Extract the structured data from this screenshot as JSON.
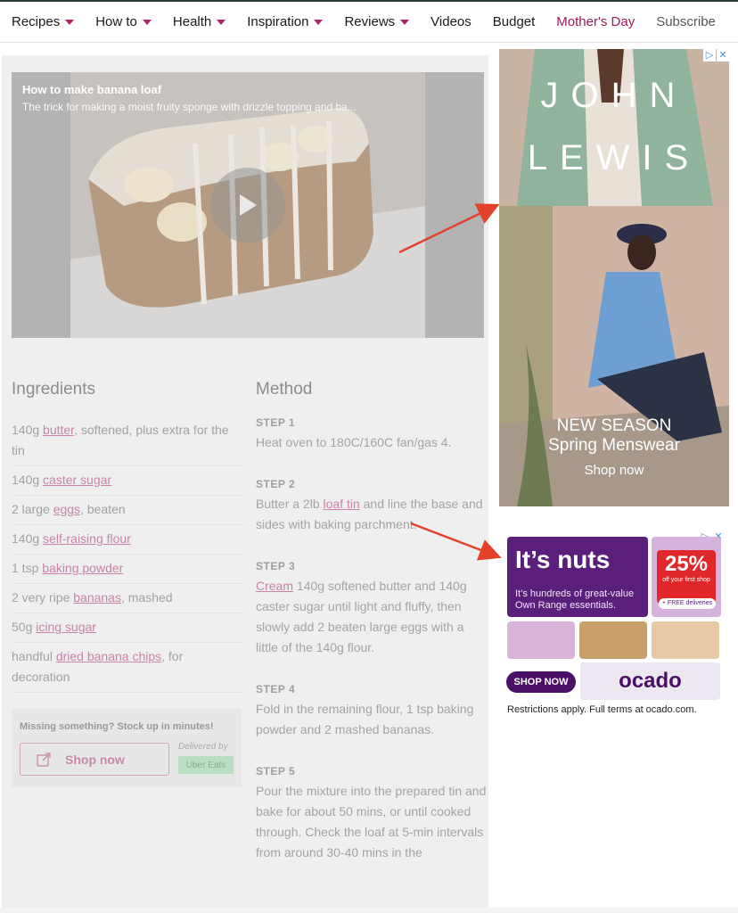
{
  "nav": {
    "items": [
      {
        "label": "Recipes",
        "dropdown": true
      },
      {
        "label": "How to",
        "dropdown": true
      },
      {
        "label": "Health",
        "dropdown": true
      },
      {
        "label": "Inspiration",
        "dropdown": true
      },
      {
        "label": "Reviews",
        "dropdown": true
      },
      {
        "label": "Videos",
        "dropdown": false
      },
      {
        "label": "Budget",
        "dropdown": false
      },
      {
        "label": "Mother's Day",
        "dropdown": false
      },
      {
        "label": "Subscribe",
        "dropdown": false
      }
    ],
    "accent_color": "#b0246a"
  },
  "video": {
    "title": "How to make banana loaf",
    "subtitle": "The trick for making a moist fruity sponge with drizzle topping and ba..."
  },
  "ingredients": {
    "heading": "Ingredients",
    "items": [
      {
        "pre": "140g ",
        "link": "butter",
        "post": ", softened, plus extra for the tin"
      },
      {
        "pre": "140g ",
        "link": "caster sugar",
        "post": ""
      },
      {
        "pre": "2 large ",
        "link": "eggs",
        "post": ", beaten"
      },
      {
        "pre": "140g ",
        "link": "self-raising flour",
        "post": ""
      },
      {
        "pre": "1 tsp ",
        "link": "baking powder",
        "post": ""
      },
      {
        "pre": "2 very ripe ",
        "link": "bananas",
        "post": ", mashed"
      },
      {
        "pre": "50g ",
        "link": "icing sugar",
        "post": ""
      },
      {
        "pre": "handful ",
        "link": "dried banana chips",
        "post": ", for decoration"
      }
    ],
    "missing": {
      "title": "Missing something? Stock up in minutes!",
      "shop_label": "Shop now",
      "delivered_by": "Delivered by",
      "partner": "Uber Eats"
    }
  },
  "method": {
    "heading": "Method",
    "steps": [
      {
        "label": "STEP 1",
        "pre": "Heat oven to 180C/160C fan/gas 4.",
        "link": "",
        "post": ""
      },
      {
        "label": "STEP 2",
        "pre": "Butter a 2lb ",
        "link": "loaf tin",
        "post": " and line the base and sides with baking parchment."
      },
      {
        "label": "STEP 3",
        "pre": "",
        "link": "Cream",
        "post": " 140g softened butter and 140g caster sugar until light and fluffy, then slowly add 2 beaten large eggs with a little of the 140g flour."
      },
      {
        "label": "STEP 4",
        "pre": "Fold in the remaining flour, 1 tsp baking powder and 2 mashed bananas.",
        "link": "",
        "post": ""
      },
      {
        "label": "STEP 5",
        "pre": "Pour the mixture into the prepared tin and bake for about 50 mins, or until cooked through. Check the loaf at 5-min intervals from around 30-40 mins in the",
        "link": "",
        "post": ""
      }
    ]
  },
  "ad_john_lewis": {
    "logo_line1": "JOHN",
    "logo_line2": "LEWIS",
    "headline1": "NEW SEASON",
    "headline2": "Spring Menswear",
    "cta": "Shop now",
    "adchoices": "▷",
    "close": "✕"
  },
  "ad_ocado": {
    "headline": "It’s nuts",
    "sub": "It’s hundreds of great-value Own Range essentials.",
    "pct": "25%",
    "pct_sub": "off your first shop",
    "free": "+ FREE deliveries",
    "cta": "SHOP NOW",
    "brand": "ocado",
    "terms": "Restrictions apply. Full terms at ocado.com.",
    "adchoices": "▷",
    "close": "✕"
  }
}
